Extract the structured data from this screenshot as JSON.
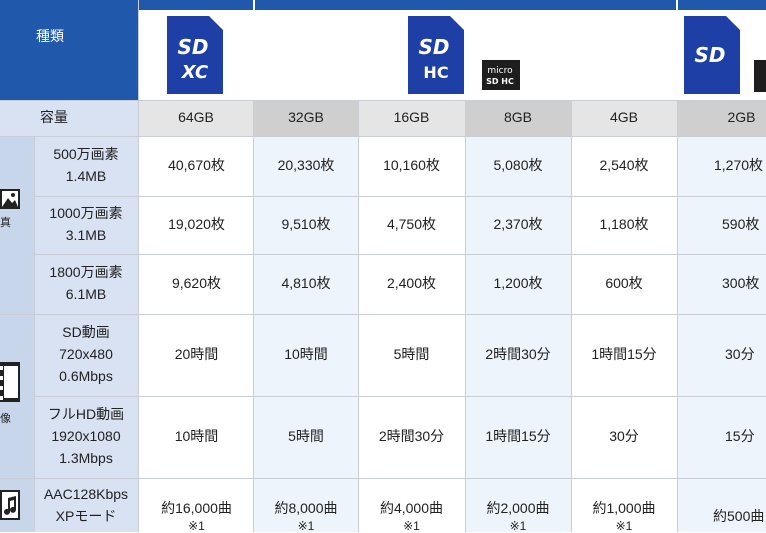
{
  "header": {
    "type_label": "種類",
    "capacity_label": "容量"
  },
  "colors": {
    "header_blue": "#2058ac",
    "card_blue": "#1d3fa6",
    "row_label_bg": "#d8e2f2",
    "capacity_bg_a": "#e5e5e5",
    "capacity_bg_b": "#cfcfcf",
    "alt_col_bg": "#eef4fc"
  },
  "cards": {
    "sdxc": {
      "line1": "SD",
      "line2": "XC"
    },
    "sdhc": {
      "line1": "SD",
      "line2": "HC"
    },
    "microsd": {
      "line1": "micro",
      "line2": "SD HC"
    },
    "sd": {
      "line1": "SD"
    }
  },
  "capacities": [
    "64GB",
    "32GB",
    "16GB",
    "8GB",
    "4GB",
    "2GB"
  ],
  "categories": {
    "photo": {
      "icon": "photo-icon",
      "char": "真"
    },
    "video": {
      "icon": "film-icon",
      "char": "像"
    },
    "music": {
      "icon": "music-icon"
    }
  },
  "rows": [
    {
      "label": [
        "500万画素",
        "1.4MB"
      ],
      "values": [
        "40,670枚",
        "20,330枚",
        "10,160枚",
        "5,080枚",
        "2,540枚",
        "1,270枚"
      ]
    },
    {
      "label": [
        "1000万画素",
        "3.1MB"
      ],
      "values": [
        "19,020枚",
        "9,510枚",
        "4,750枚",
        "2,370枚",
        "1,180枚",
        "590枚"
      ]
    },
    {
      "label": [
        "1800万画素",
        "6.1MB"
      ],
      "values": [
        "9,620枚",
        "4,810枚",
        "2,400枚",
        "1,200枚",
        "600枚",
        "300枚"
      ]
    },
    {
      "label": [
        "SD動画",
        "720x480",
        "0.6Mbps"
      ],
      "values": [
        "20時間",
        "10時間",
        "5時間",
        "2時間30分",
        "1時間15分",
        "30分"
      ]
    },
    {
      "label": [
        "フルHD動画",
        "1920x1080",
        "1.3Mbps"
      ],
      "values": [
        "10時間",
        "5時間",
        "2時間30分",
        "1時間15分",
        "30分",
        "15分"
      ]
    },
    {
      "label": [
        "AAC128Kbps",
        "XPモード"
      ],
      "values": [
        "約16,000曲",
        "約8,000曲",
        "約4,000曲",
        "約2,000曲",
        "約1,000曲",
        "約500曲"
      ],
      "notes": [
        "※1",
        "※1",
        "※1",
        "※1",
        "※1",
        ""
      ]
    }
  ]
}
